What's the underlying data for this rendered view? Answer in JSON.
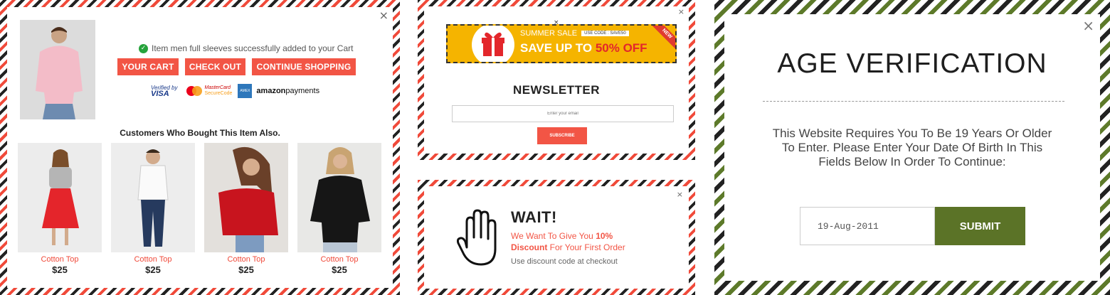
{
  "cart_popup": {
    "added_message": "Item men full sleeves successfully added to your Cart",
    "buttons": {
      "your_cart": "YOUR CART",
      "check_out": "CHECK OUT",
      "continue_shopping": "CONTINUE SHOPPING"
    },
    "payments": {
      "visa_top": "Verified by",
      "visa": "VISA",
      "mc_top": "MasterCard",
      "mc_bottom": "SecureCode",
      "amex": "AMEX",
      "amazon": "amazon",
      "amazon_suffix": "payments"
    },
    "also_bought_title": "Customers Who Bought This Item Also.",
    "products": [
      {
        "name": "Cotton Top",
        "price": "$25"
      },
      {
        "name": "Cotton Top",
        "price": "$25"
      },
      {
        "name": "Cotton Top",
        "price": "$25"
      },
      {
        "name": "Cotton Top",
        "price": "$25"
      }
    ],
    "close": "×"
  },
  "newsletter_popup": {
    "banner": {
      "sale_label": "SUMMER SALE",
      "code_label": "USE CODE : SAVE50",
      "save_text": "SAVE UP TO",
      "off_text": "50% OFF",
      "ribbon": "NEW"
    },
    "title": "NEWSLETTER",
    "email_placeholder": "Enter your email",
    "subscribe": "SUBSCRIBE",
    "close": "×",
    "banner_close": "×"
  },
  "wait_popup": {
    "title": "WAIT!",
    "line1_pre": "We Want To Give You ",
    "line1_bold": "10%",
    "line2_bold": "Discount",
    "line2_post": " For Your First Order",
    "note": "Use discount code at checkout",
    "close": "×"
  },
  "age_popup": {
    "title": "AGE VERIFICATION",
    "message": "This Website Requires You To Be 19 Years Or Older To Enter. Please Enter Your Date Of Birth In This Fields Below In Order To Continue:",
    "date_value": "19-Aug-2011",
    "submit": "SUBMIT",
    "close": "×"
  },
  "colors": {
    "accent_red": "#f25545",
    "olive_green": "#5b7327",
    "banner_yellow": "#f5b400"
  }
}
